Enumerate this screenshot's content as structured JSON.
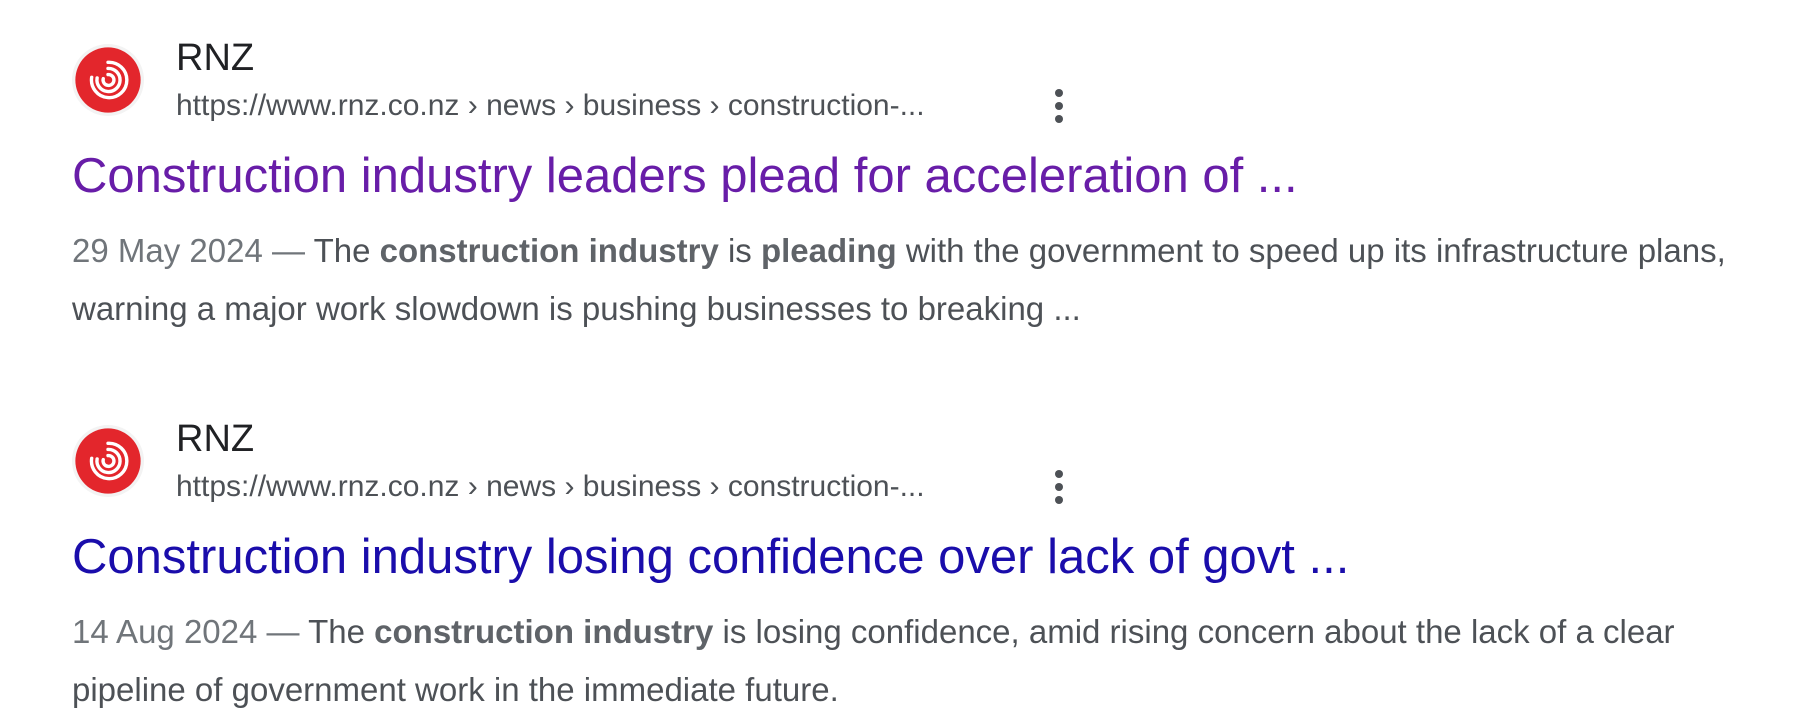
{
  "results": [
    {
      "site_name": "RNZ",
      "url": "https://www.rnz.co.nz › news › business › construction-...",
      "title": "Construction industry leaders plead for acceleration of ...",
      "title_state": "visited",
      "date": "29 May 2024",
      "separator": " — ",
      "snippet_parts": [
        {
          "text": "The ",
          "bold": false
        },
        {
          "text": "construction industry",
          "bold": true
        },
        {
          "text": " is ",
          "bold": false
        },
        {
          "text": "pleading",
          "bold": true
        },
        {
          "text": " with the government to speed up its infrastructure plans, warning a major work slowdown is pushing businesses to breaking ...",
          "bold": false
        }
      ],
      "favicon": "rnz-logo-icon",
      "menu_icon": "more-vert-icon"
    },
    {
      "site_name": "RNZ",
      "url": "https://www.rnz.co.nz › news › business › construction-...",
      "title": "Construction industry losing confidence over lack of govt ...",
      "title_state": "unvisited",
      "date": "14 Aug 2024",
      "separator": " — ",
      "snippet_parts": [
        {
          "text": "The ",
          "bold": false
        },
        {
          "text": "construction industry",
          "bold": true
        },
        {
          "text": " is losing confidence, amid rising concern about the lack of a clear pipeline of government work in the immediate future.",
          "bold": false
        }
      ],
      "favicon": "rnz-logo-icon",
      "menu_icon": "more-vert-icon"
    }
  ],
  "colors": {
    "link_visited": "#681da8",
    "link_unvisited": "#1a0dab",
    "snippet_text": "#4d5156",
    "date_text": "#70757a",
    "brand_red": "#e3262c"
  }
}
